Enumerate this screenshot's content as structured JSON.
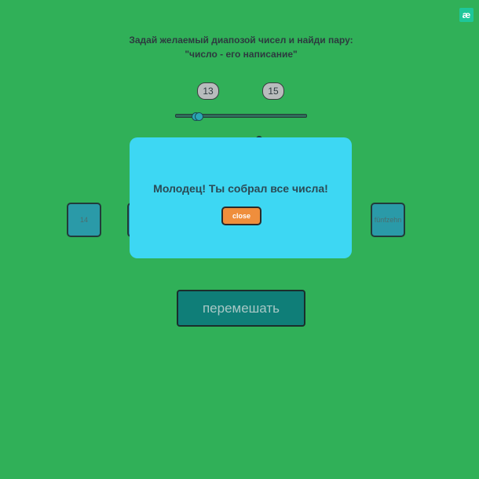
{
  "logo": {
    "text": "æ",
    "icon": "app-logo-icon"
  },
  "instructions": {
    "line1": "Задай желаемый диапозой чисел и найди пару:",
    "line2": "\"число - его написание\""
  },
  "range": {
    "min_value": "13",
    "max_value": "15"
  },
  "cards": {
    "left": "14",
    "right": "fünfzehn"
  },
  "shuffle_label": "перемешать",
  "modal": {
    "message": "Молодец! Ты собрал все числа!",
    "close_label": "close"
  },
  "colors": {
    "background": "#30b058",
    "modal": "#3dd7f3",
    "close_button": "#ef8e3c",
    "shuffle_button": "#0f7e78",
    "card": "#2a9aa8"
  }
}
